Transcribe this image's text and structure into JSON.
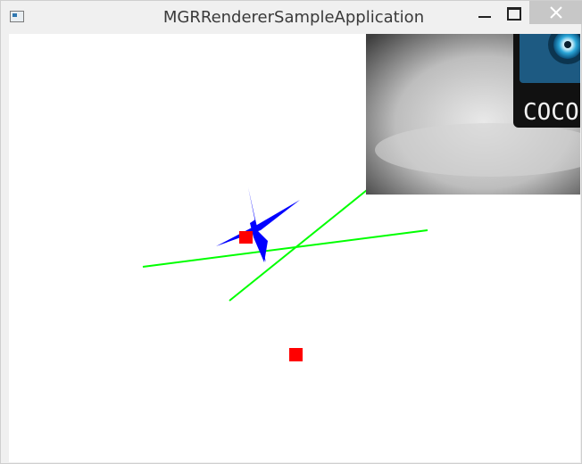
{
  "window": {
    "title": "MGRRendererSampleApplication"
  },
  "icons": {
    "app": "application-icon",
    "minimize": "minimize-icon",
    "maximize": "maximize-icon",
    "close": "close-icon"
  },
  "scene": {
    "sprite_text": "COCOS",
    "colors": {
      "line": "#00ff00",
      "point": "#ff0000",
      "shape": "#0000ff"
    }
  }
}
